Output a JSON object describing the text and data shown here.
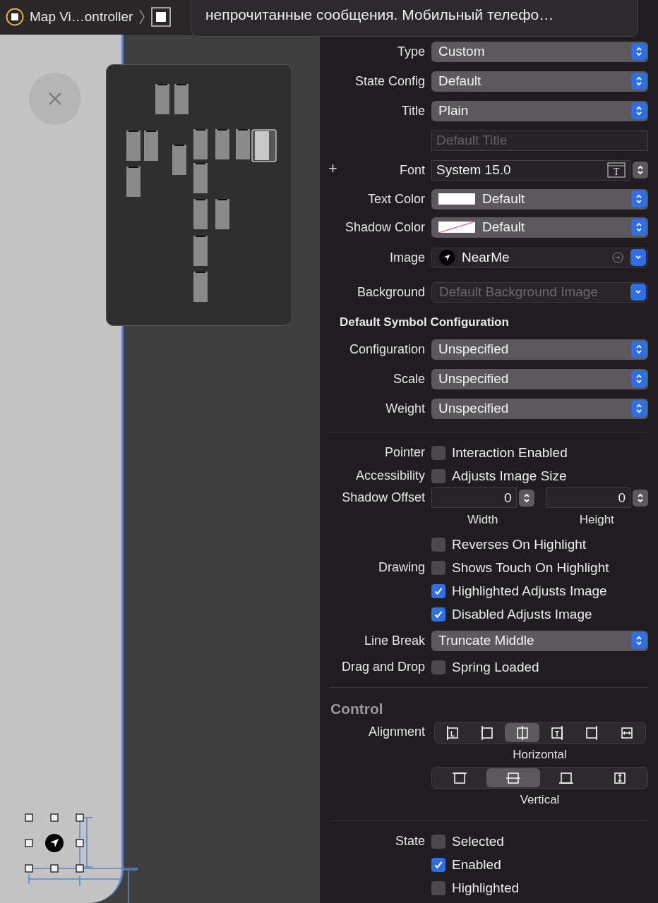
{
  "breadcrumb": {
    "items": [
      {
        "kind": "scene",
        "label": "Map Vi…ontroller"
      },
      {
        "kind": "view"
      }
    ]
  },
  "tooltip": {
    "text": "непрочитанные сообщения. Мобильный телефо…"
  },
  "inspector": {
    "rows": [
      {
        "kind": "popup",
        "label": "Type",
        "value": "Custom"
      },
      {
        "kind": "popup",
        "label": "State Config",
        "value": "Default"
      },
      {
        "kind": "popup",
        "label": "Title",
        "value": "Plain"
      },
      {
        "kind": "text-field",
        "placeholder": "Default Title"
      },
      {
        "kind": "font",
        "label": "Font",
        "value": "System 15.0",
        "add_glyph": "+",
        "icon_glyph": "T"
      },
      {
        "kind": "color",
        "label": "Text Color",
        "value": "Default",
        "color": "#ffffff"
      },
      {
        "kind": "color-empty",
        "label": "Shadow Color",
        "value": "Default"
      },
      {
        "kind": "image",
        "label": "Image",
        "value": "NearMe"
      },
      {
        "kind": "image-empty",
        "label": "Background",
        "placeholder": "Default Background Image"
      },
      {
        "kind": "subheader",
        "label": "Default Symbol Configuration"
      },
      {
        "kind": "popup",
        "label": "Configuration",
        "value": "Unspecified"
      },
      {
        "kind": "popup",
        "label": "Scale",
        "value": "Unspecified"
      },
      {
        "kind": "popup",
        "label": "Weight",
        "value": "Unspecified"
      },
      {
        "kind": "divider"
      },
      {
        "kind": "checkbox",
        "label": "Pointer",
        "text": "Interaction Enabled",
        "checked": false
      },
      {
        "kind": "checkbox",
        "label": "Accessibility",
        "text": "Adjusts Image Size",
        "checked": false
      },
      {
        "kind": "offset",
        "label": "Shadow Offset",
        "fields": [
          {
            "value": "0",
            "caption": "Width"
          },
          {
            "value": "0",
            "caption": "Height"
          }
        ]
      },
      {
        "kind": "checkbox",
        "text": "Reverses On Highlight",
        "checked": false
      },
      {
        "kind": "checkbox",
        "label": "Drawing",
        "text": "Shows Touch On Highlight",
        "checked": false
      },
      {
        "kind": "checkbox",
        "text": "Highlighted Adjusts Image",
        "checked": true
      },
      {
        "kind": "checkbox",
        "text": "Disabled Adjusts Image",
        "checked": true
      },
      {
        "kind": "popup",
        "label": "Line Break",
        "value": "Truncate Middle"
      },
      {
        "kind": "checkbox",
        "label": "Drag and Drop",
        "text": "Spring Loaded",
        "checked": false
      },
      {
        "kind": "divider"
      },
      {
        "kind": "section",
        "label": "Control"
      },
      {
        "kind": "segmented",
        "label": "Alignment",
        "caption": "Horizontal",
        "items": [
          {
            "kind": "left",
            "glyph": "L",
            "selected": false
          },
          {
            "kind": "leading",
            "selected": false
          },
          {
            "kind": "center",
            "selected": true
          },
          {
            "kind": "trailing",
            "glyph": "T",
            "selected": false
          },
          {
            "kind": "right",
            "selected": false
          },
          {
            "kind": "fill",
            "selected": false
          }
        ]
      },
      {
        "kind": "segmented",
        "caption": "Vertical",
        "items": [
          {
            "kind": "top",
            "selected": false
          },
          {
            "kind": "middle",
            "selected": true
          },
          {
            "kind": "bottom",
            "selected": false
          },
          {
            "kind": "stretch",
            "selected": false
          }
        ]
      },
      {
        "kind": "divider"
      },
      {
        "kind": "checkbox",
        "label": "State",
        "text": "Selected",
        "checked": false
      },
      {
        "kind": "checkbox",
        "text": "Enabled",
        "checked": true
      },
      {
        "kind": "checkbox",
        "text": "Highlighted",
        "checked": false
      }
    ]
  }
}
